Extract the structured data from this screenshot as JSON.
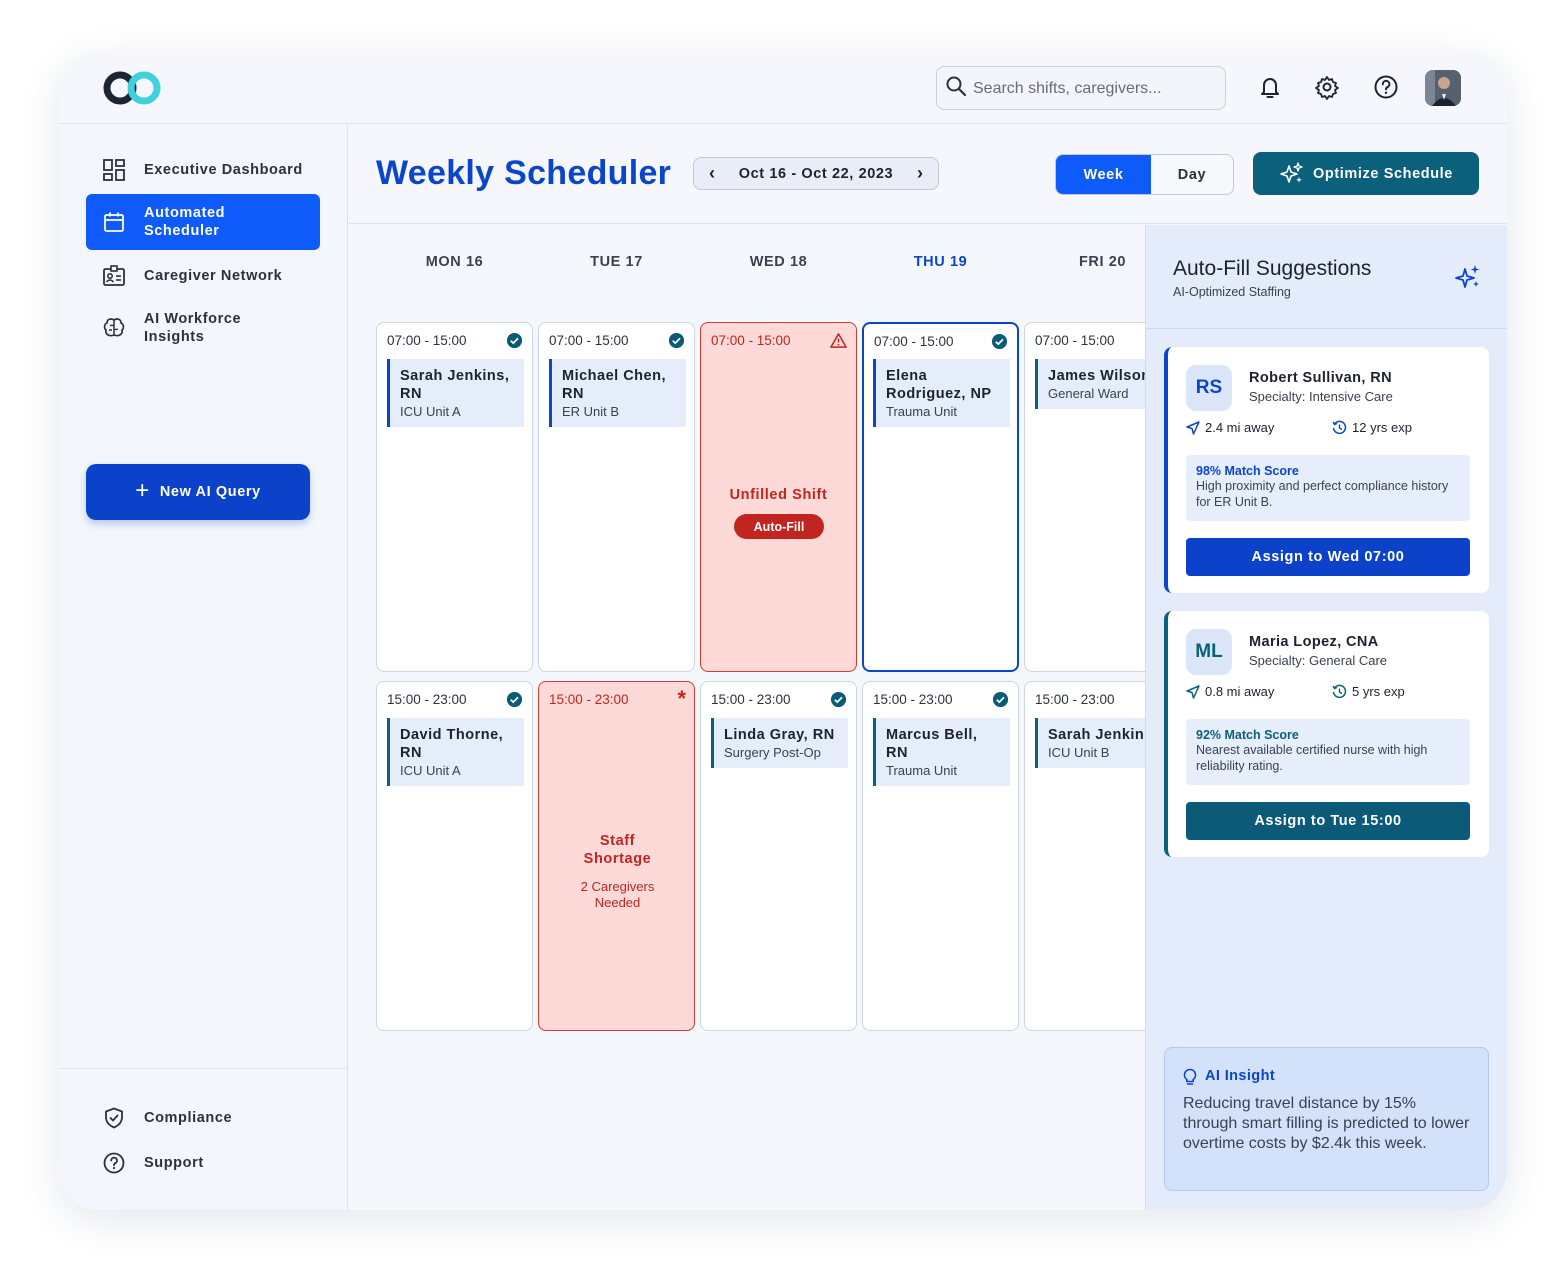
{
  "header": {
    "search_placeholder": "Search shifts, caregivers..."
  },
  "sidebar": {
    "items": [
      {
        "label": "Executive Dashboard"
      },
      {
        "label": "Automated Scheduler"
      },
      {
        "label": "Caregiver Network"
      },
      {
        "label": "AI Workforce Insights"
      }
    ],
    "new_query": "New AI Query",
    "bottom": [
      {
        "label": "Compliance"
      },
      {
        "label": "Support"
      }
    ]
  },
  "main": {
    "title": "Weekly Scheduler",
    "date_range": "Oct 16 - Oct 22, 2023",
    "view_week": "Week",
    "view_day": "Day",
    "optimize": "Optimize Schedule",
    "days": [
      "MON 16",
      "TUE 17",
      "WED 18",
      "THU 19",
      "FRI 20"
    ],
    "rows": [
      [
        {
          "time": "07:00 - 15:00",
          "name": "Sarah Jenkins, RN",
          "unit": "ICU Unit A"
        },
        {
          "time": "07:00 - 15:00",
          "name": "Michael Chen, RN",
          "unit": "ER Unit B"
        },
        {
          "time": "07:00 - 15:00",
          "alert": "Unfilled Shift",
          "action": "Auto-Fill"
        },
        {
          "time": "07:00 - 15:00",
          "name": "Elena Rodriguez, NP",
          "unit": "Trauma Unit"
        },
        {
          "time": "07:00 - 15:00",
          "name": "James Wilson, RN",
          "unit": "General Ward"
        }
      ],
      [
        {
          "time": "15:00 - 23:00",
          "name": "David Thorne, RN",
          "unit": "ICU Unit A"
        },
        {
          "time": "15:00 - 23:00",
          "alert": "Staff Shortage",
          "sub": "2 Caregivers Needed"
        },
        {
          "time": "15:00 - 23:00",
          "name": "Linda Gray, RN",
          "unit": "Surgery Post-Op"
        },
        {
          "time": "15:00 - 23:00",
          "name": "Marcus Bell, RN",
          "unit": "Trauma Unit"
        },
        {
          "time": "15:00 - 23:00",
          "name": "Sarah Jenkins, RN",
          "unit": "ICU Unit B"
        }
      ]
    ]
  },
  "panel": {
    "title": "Auto-Fill Suggestions",
    "subtitle": "AI-Optimized Staffing",
    "suggestions": [
      {
        "initials": "RS",
        "name": "Robert Sullivan, RN",
        "specialty": "Specialty: Intensive Care",
        "distance": "2.4 mi away",
        "experience": "12 yrs exp",
        "match": "98% Match Score",
        "reason": "High proximity and perfect compliance history for ER Unit B.",
        "action": "Assign to Wed 07:00"
      },
      {
        "initials": "ML",
        "name": "Maria Lopez, CNA",
        "specialty": "Specialty: General Care",
        "distance": "0.8 mi away",
        "experience": "5 yrs exp",
        "match": "92% Match Score",
        "reason": "Nearest available certified nurse with high reliability rating.",
        "action": "Assign to Tue 15:00"
      }
    ],
    "insight_title": "AI Insight",
    "insight_text": "Reducing travel distance by 15% through smart filling is predicted to lower overtime costs by $2.4k this week."
  },
  "colors": {
    "primary": "#0f5bfa",
    "primary_dark": "#0b42c9",
    "teal": "#0b607c",
    "alert": "#c0261f",
    "alert_bg": "#fdd9d7"
  }
}
